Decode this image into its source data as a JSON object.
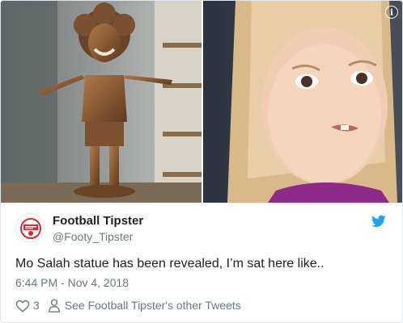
{
  "card": {
    "info_icon": "info-icon",
    "info_glyph": "i"
  },
  "author": {
    "display_name": "Football Tipster",
    "handle": "@Footy_Tipster",
    "avatar_icon": "football-tipster-logo",
    "verified_bird_icon": "twitter-bird-icon"
  },
  "tweet": {
    "text": "Mo Salah statue has been revealed, I’m sat here like..",
    "timestamp": "6:44 PM - Nov 4, 2018"
  },
  "actions": {
    "like_icon": "heart-icon",
    "like_count": "3",
    "profile_icon": "person-icon",
    "other_tweets_label": "See Football Tipster's other Tweets"
  },
  "colors": {
    "twitter_blue": "#1da1f2",
    "text_primary": "#1c2022",
    "text_secondary": "#697882",
    "border": "#e1e8ed",
    "logo_red": "#d7282f"
  }
}
